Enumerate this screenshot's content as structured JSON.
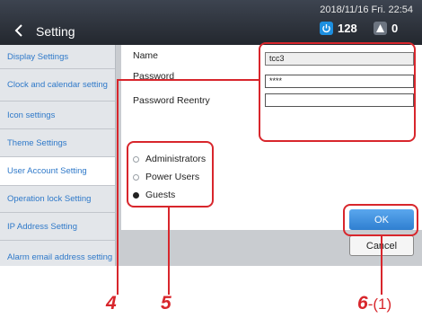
{
  "header": {
    "title": "Setting",
    "datetime": "2018/11/16 Fri. 22:54",
    "status_count_1": "128",
    "status_count_2": "0"
  },
  "sidebar": {
    "items": [
      {
        "label": "Display Settings"
      },
      {
        "label": "Clock and calendar setting"
      },
      {
        "label": "Icon settings"
      },
      {
        "label": "Theme Settings"
      },
      {
        "label": "User Account Setting",
        "active": true
      },
      {
        "label": "Operation lock Setting"
      },
      {
        "label": "IP Address Setting"
      },
      {
        "label": "Alarm email address setting"
      }
    ]
  },
  "form": {
    "name_label": "Name",
    "name_value": "tcc3",
    "password_label": "Password",
    "password_value": "****",
    "reentry_label": "Password Reentry",
    "reentry_value": ""
  },
  "roles": {
    "options": [
      "Administrators",
      "Power Users",
      "Guests"
    ],
    "selected": "Guests"
  },
  "buttons": {
    "ok": "OK",
    "cancel": "Cancel"
  },
  "callouts": {
    "c4": "4",
    "c5": "5",
    "c6": "6",
    "c6_sub": "-(1)"
  },
  "colors": {
    "accent": "#2f79c9",
    "highlight": "#d8262c"
  },
  "icons": {
    "back": "chevron-left-icon",
    "power": "power-icon",
    "alarm": "alarm-icon"
  }
}
